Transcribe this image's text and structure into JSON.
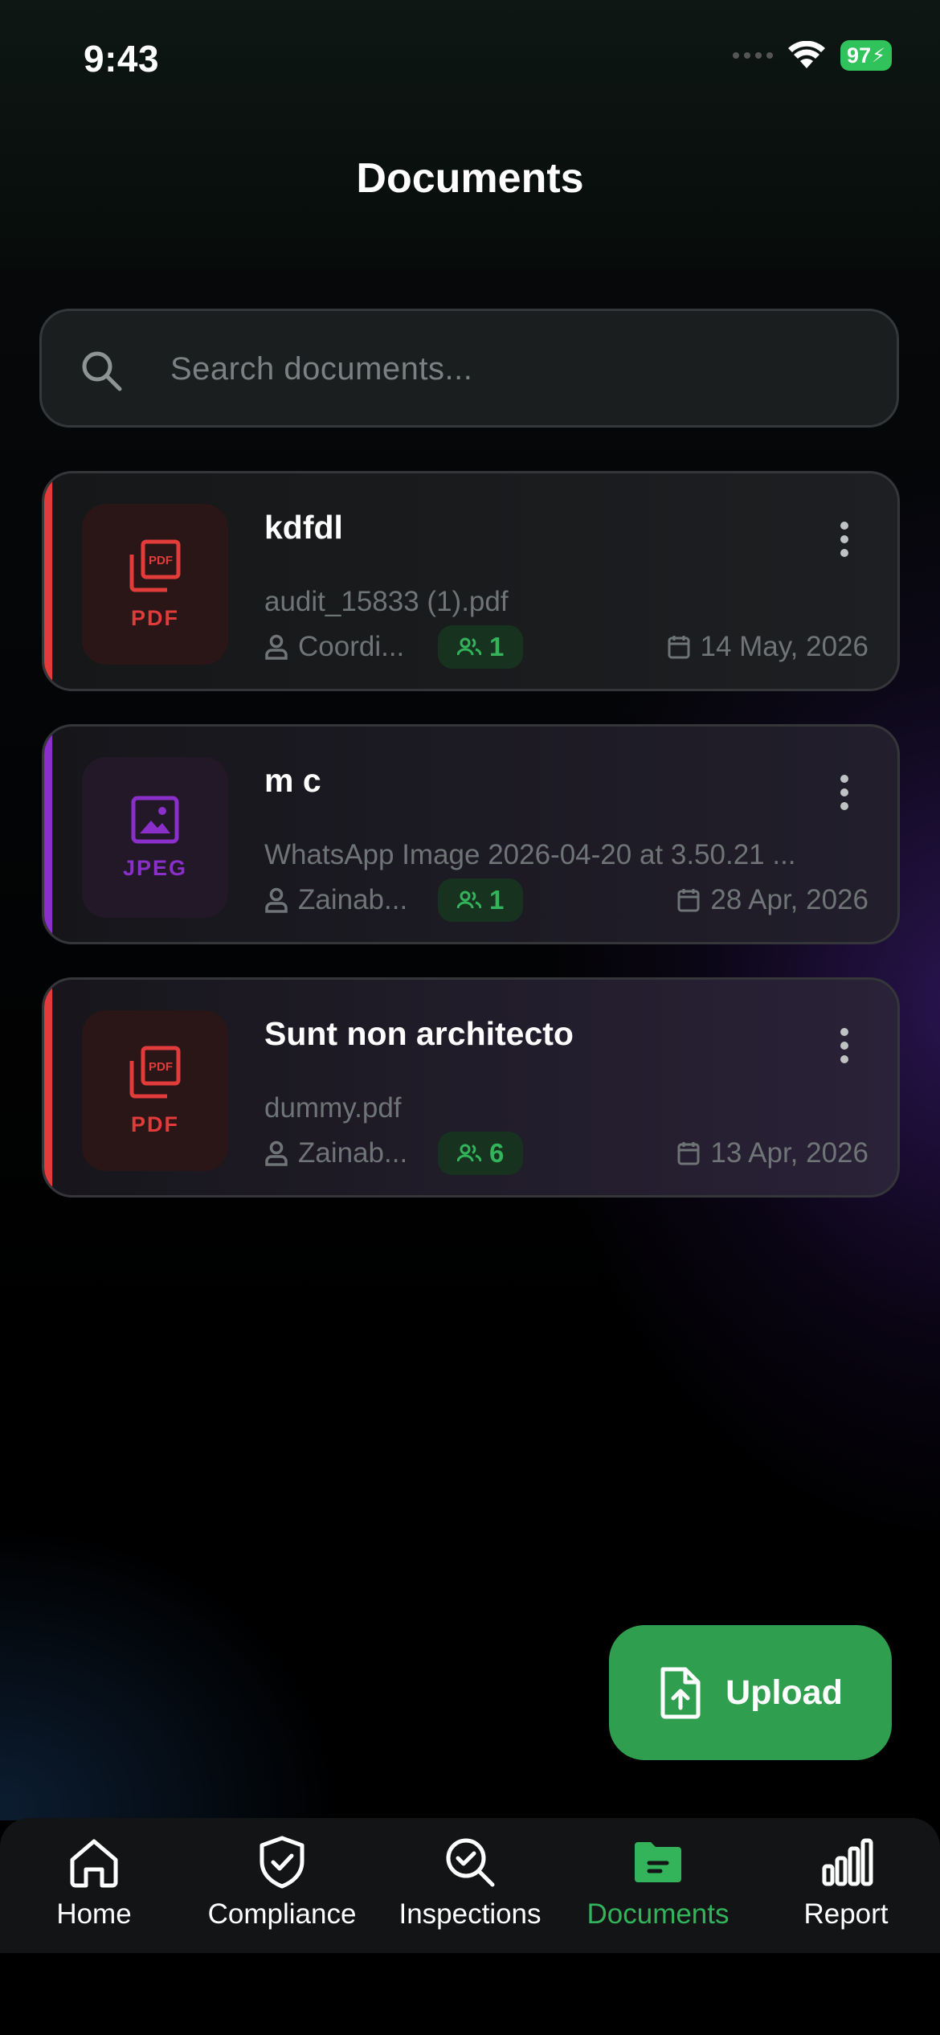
{
  "status": {
    "time": "9:43",
    "battery": "97"
  },
  "header": {
    "title": "Documents"
  },
  "search": {
    "placeholder": "Search documents..."
  },
  "documents": [
    {
      "title": "kdfdl",
      "filename": "audit_15833 (1).pdf",
      "type": "PDF",
      "owner": "Coordi...",
      "shared_count": "1",
      "date": "14 May, 2026",
      "color": "#e23b3b"
    },
    {
      "title": "m c",
      "filename": "WhatsApp Image 2026-04-20 at 3.50.21 ...",
      "type": "JPEG",
      "owner": "Zainab...",
      "shared_count": "1",
      "date": "28 Apr, 2026",
      "color": "#8a2fc9"
    },
    {
      "title": "Sunt non architecto",
      "filename": "dummy.pdf",
      "type": "PDF",
      "owner": "Zainab...",
      "shared_count": "6",
      "date": "13 Apr, 2026",
      "color": "#e23b3b"
    }
  ],
  "fab": {
    "label": "Upload"
  },
  "nav": [
    {
      "label": "Home",
      "icon": "home-icon"
    },
    {
      "label": "Compliance",
      "icon": "shield-check-icon"
    },
    {
      "label": "Inspections",
      "icon": "search-check-icon"
    },
    {
      "label": "Documents",
      "icon": "folder-icon",
      "active": true
    },
    {
      "label": "Report",
      "icon": "bar-chart-icon"
    }
  ],
  "colors": {
    "accent": "#2f9f4f",
    "pdf": "#e23b3b",
    "jpeg": "#8a2fc9"
  }
}
